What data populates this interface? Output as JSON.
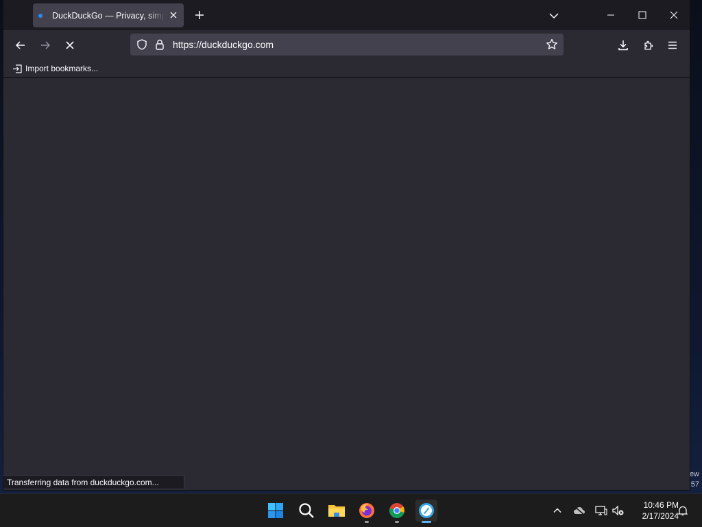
{
  "browser": {
    "tab": {
      "title": "DuckDuckGo — Privacy, simplified."
    },
    "address_bar": {
      "url": "https://duckduckgo.com"
    },
    "bookmarks": {
      "import_label": "Import bookmarks..."
    },
    "status": {
      "text": "Transferring data from duckduckgo.com..."
    }
  },
  "desktop": {
    "edge_text_1": "ew",
    "edge_text_2": "57"
  },
  "taskbar": {
    "apps": [
      "start",
      "search",
      "file-explorer",
      "firefox",
      "chrome",
      "active-app"
    ],
    "clock": {
      "time": "10:46 PM",
      "date": "2/17/2024"
    }
  },
  "colors": {
    "accent": "#2a8af7",
    "window_bg": "#2b2a33",
    "titlebar_bg": "#1c1b22"
  }
}
